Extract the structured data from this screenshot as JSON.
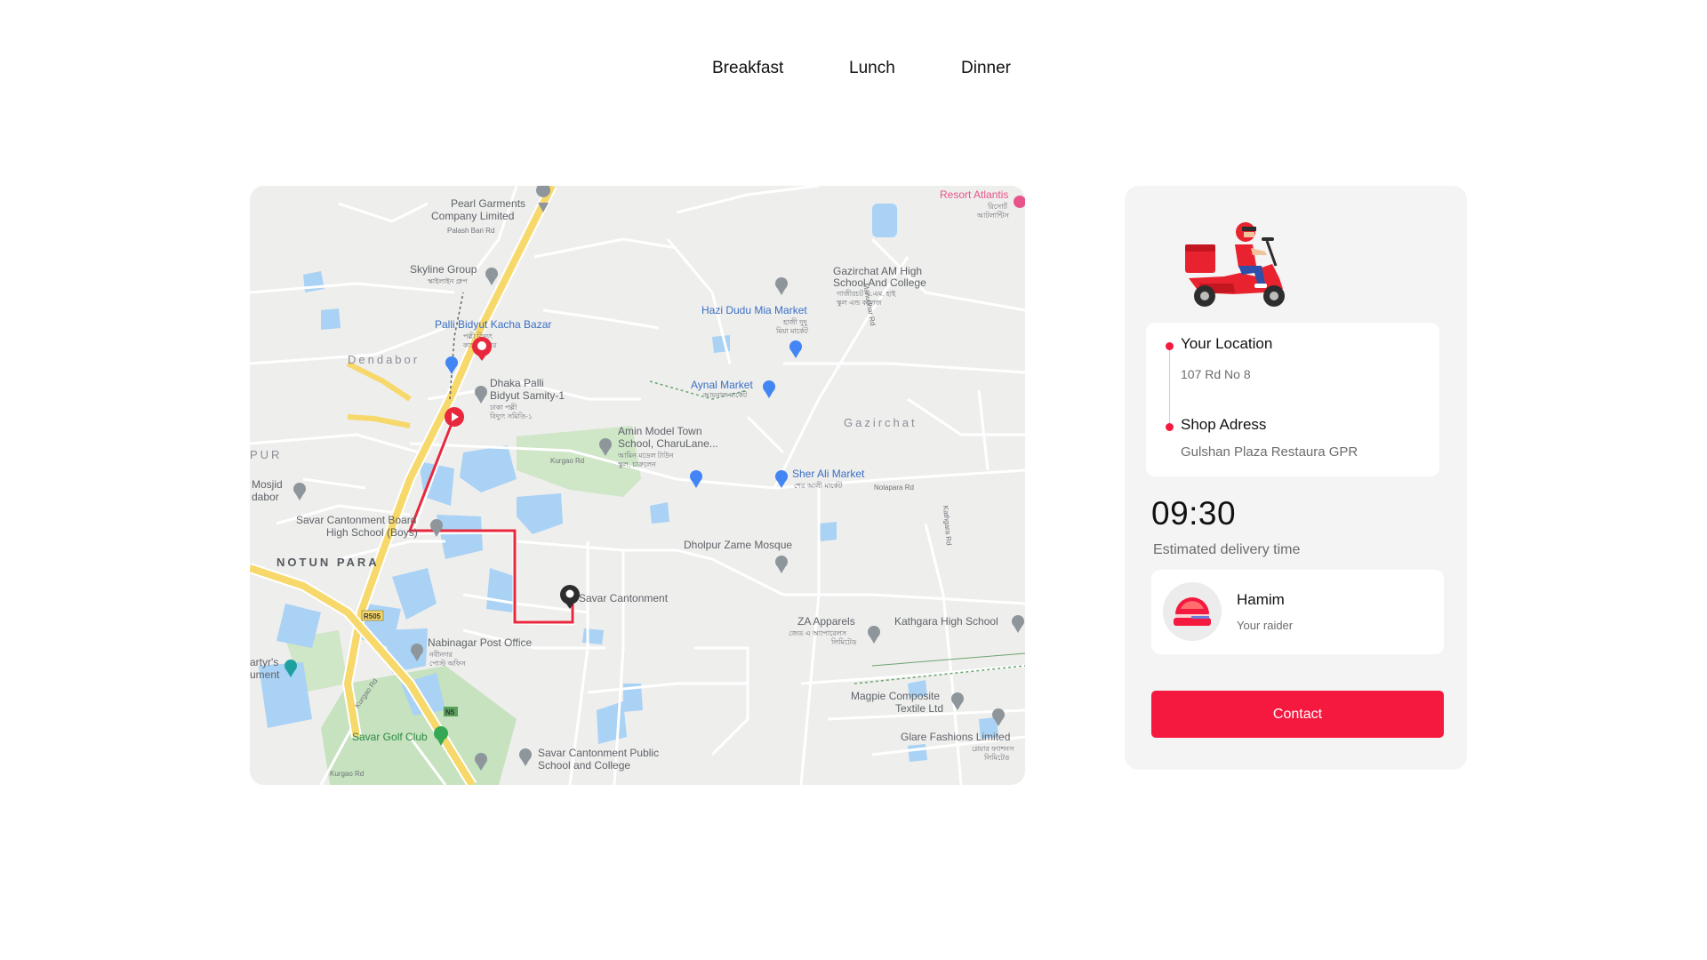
{
  "nav": {
    "items": [
      {
        "label": "Breakfast"
      },
      {
        "label": "Lunch"
      },
      {
        "label": "Dinner"
      }
    ]
  },
  "map": {
    "labels": {
      "pearl_1": "Pearl Garments",
      "pearl_2": "Company Limited",
      "palashbari_rd": "Palash Bari Rd",
      "skyline_1": "Skyline Group",
      "skyline_2": "স্কাইলাইন গ্রুপ",
      "palli_1": "Palli Bidyut Kacha Bazar",
      "palli_2": "পল্লী বিদ্যুৎ",
      "palli_3": "কাচা বাজার",
      "dendabor": "Dendabor",
      "dhaka_1": "Dhaka Palli",
      "dhaka_2": "Bidyut Samity-1",
      "dhaka_3": "ঢাকা পল্লী",
      "dhaka_4": "বিদ্যুৎ সমিতি-১",
      "pur": "PUR",
      "mosjid_1": "Mosjid",
      "mosjid_2": "dabor",
      "savar_board_1": "Savar Cantonment Board",
      "savar_board_2": "High School (Boys)",
      "notun_para": "NOTUN PARA",
      "gazirchat_school_1": "Gazirchat AM High",
      "gazirchat_school_2": "School And College",
      "gazirchat_school_3": "গাজীরচট এ.এম. হাই",
      "gazirchat_school_4": "স্কুল এন্ড কলেজ",
      "hazi_1": "Hazi Dudu Mia Market",
      "hazi_2": "হাজী দুদু",
      "hazi_3": "মিয়া মার্কেট",
      "aynal_1": "Aynal Market",
      "aynal_2": "আয়নাল মার্কেট",
      "gazirchat": "Gazirchat",
      "amin_1": "Amin Model Town",
      "amin_2": "School, CharuLane...",
      "amin_3": "আমিন মডেল টাউন",
      "amin_4": "স্কুল, চারুলেন",
      "sher_1": "Sher Ali Market",
      "sher_2": "শের আলী মার্কেট",
      "dholpur": "Dholpur Zame Mosque",
      "savar_cantonment": "Savar Cantonment",
      "resort_1": "Resort Atlantis",
      "resort_2": "রিসোর্ট",
      "resort_3": "আটলান্টিস",
      "za_1": "ZA Apparels",
      "za_2": "জেড এ অ্যাপারেলস",
      "za_3": "লিমিটেড",
      "kathgara": "Kathgara High School",
      "nabinagar_1": "Nabinagar Post Office",
      "nabinagar_2": "নবীনগর",
      "nabinagar_3": "পোস্ট অফিস",
      "martyr_1": "artyr's",
      "martyr_2": "ument",
      "golf": "Savar Golf Club",
      "public_1": "Savar Cantonment Public",
      "public_2": "School and College",
      "magpie_1": "Magpie Composite",
      "magpie_2": "Textile Ltd",
      "glare_1": "Glare Fashions Limited",
      "glare_2": "গ্লেয়ার ফ্যাশনস",
      "glare_3": "লিমিটেড",
      "r505": "R505",
      "n5": "N5",
      "kurgao_rd": "Kurgao Rd",
      "nolapara_rd": "Nolapara Rd",
      "manudhar_rd": "Manudhar Rd",
      "kathgara_rd": "Kathgara Rd",
      "kumgao_rd2": "Kurgao Rd"
    }
  },
  "panel": {
    "your_location_title": "Your Location",
    "your_location_address": "107 Rd No 8",
    "shop_title": "Shop Adress",
    "shop_address": "Gulshan Plaza Restaura GPR",
    "time": "09:30",
    "time_label": "Estimated delivery time",
    "rider_name": "Hamim",
    "rider_role": "Your raider",
    "contact_label": "Contact"
  },
  "colors": {
    "accent": "#f5193f",
    "panel_bg": "#f4f4f4",
    "route": "#e8283c",
    "water": "#a9d2f5",
    "park": "#c8e6c9",
    "highway": "#f7d86a"
  },
  "icons": [
    "scooter-rider-illustration",
    "location-dot-icon",
    "map-pin-icon",
    "origin-marker-icon",
    "destination-marker-icon",
    "rider-avatar-icon"
  ]
}
